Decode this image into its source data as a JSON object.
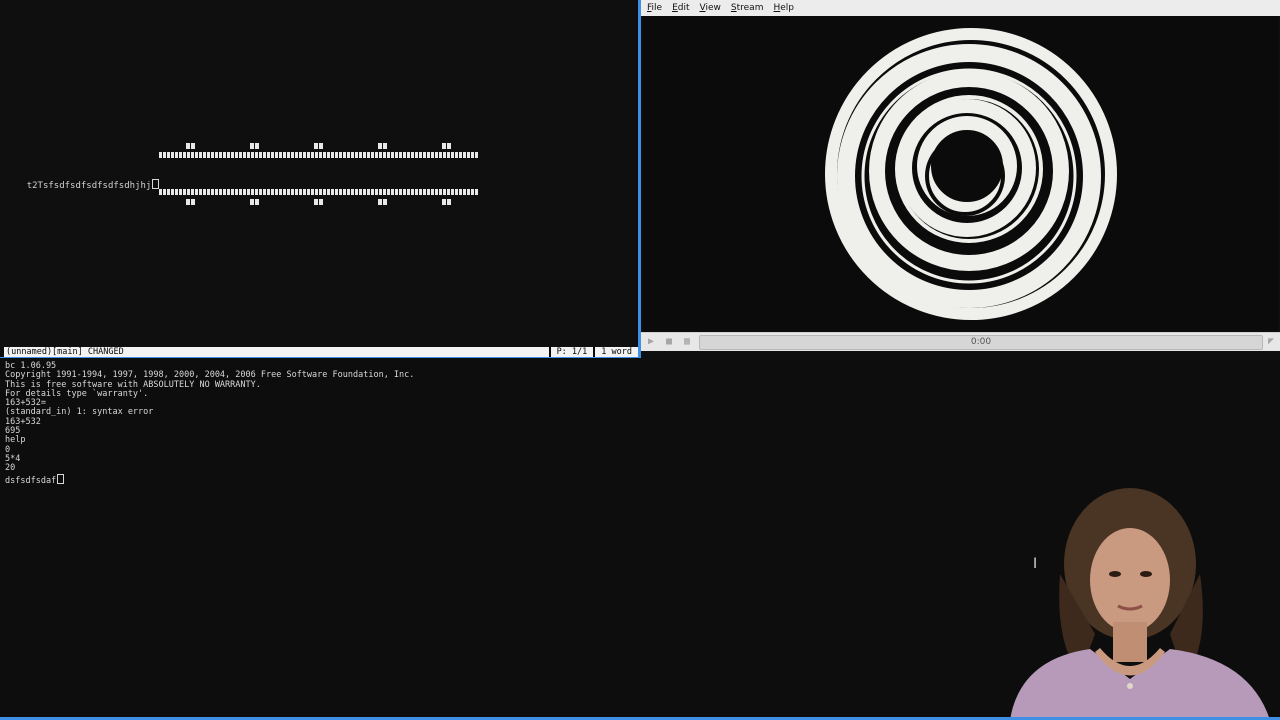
{
  "editor": {
    "text_line": "t2Tsfsdfsdfsdfsdfsdhjhj",
    "status": {
      "buffer": "(unnamed)[main] CHANGED",
      "page": "P: 1/1",
      "words": "1 word"
    }
  },
  "player": {
    "menu": [
      "File",
      "Edit",
      "View",
      "Stream",
      "Help"
    ],
    "time": "0:00",
    "icons": {
      "play": "play-icon",
      "stop": "stop-icon",
      "fullscreen": "fullscreen-icon",
      "volume": "volume-icon"
    }
  },
  "terminal": {
    "lines": [
      "bc 1.06.95",
      "Copyright 1991-1994, 1997, 1998, 2000, 2004, 2006 Free Software Foundation, Inc.",
      "This is free software with ABSOLUTELY NO WARRANTY.",
      "For details type `warranty'.",
      "163+532=",
      "(standard_in) 1: syntax error",
      "163+532",
      "695",
      "help",
      "0",
      "5*4",
      "20"
    ],
    "prompt_line": "dsfsdfsdaf"
  },
  "colors": {
    "accent": "#3f8fe6",
    "background": "#0d0d0d",
    "text": "#d8d8d8"
  }
}
